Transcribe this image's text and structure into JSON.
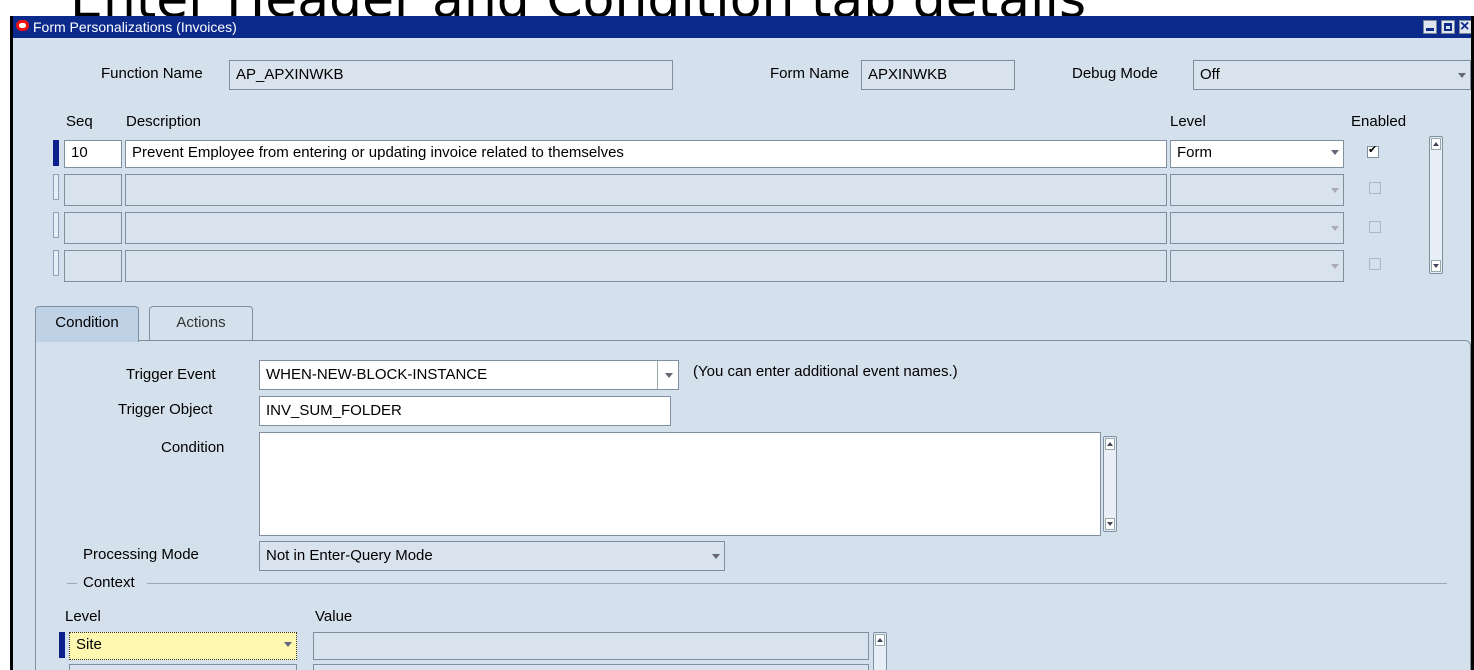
{
  "slide": {
    "heading": "Enter Header and Condition tab details"
  },
  "window": {
    "title": "Form Personalizations (Invoices)"
  },
  "header": {
    "function_name_label": "Function Name",
    "function_name_value": "AP_APXINWKB",
    "form_name_label": "Form Name",
    "form_name_value": "APXINWKB",
    "debug_mode_label": "Debug Mode",
    "debug_mode_value": "Off"
  },
  "grid": {
    "columns": {
      "seq": "Seq",
      "description": "Description",
      "level": "Level",
      "enabled": "Enabled"
    },
    "rows": [
      {
        "seq": "10",
        "description": "Prevent Employee from entering or updating invoice related to themselves",
        "level": "Form",
        "enabled": true
      },
      {
        "seq": "",
        "description": "",
        "level": "",
        "enabled": false
      },
      {
        "seq": "",
        "description": "",
        "level": "",
        "enabled": false
      },
      {
        "seq": "",
        "description": "",
        "level": "",
        "enabled": false
      }
    ]
  },
  "tabs": {
    "condition": "Condition",
    "actions": "Actions"
  },
  "condition": {
    "trigger_event_label": "Trigger Event",
    "trigger_event_value": "WHEN-NEW-BLOCK-INSTANCE",
    "trigger_event_hint": "(You can enter additional event names.)",
    "trigger_object_label": "Trigger Object",
    "trigger_object_value": "INV_SUM_FOLDER",
    "condition_label": "Condition",
    "condition_value": "",
    "processing_mode_label": "Processing Mode",
    "processing_mode_value": "Not in Enter-Query Mode",
    "context_label": "Context",
    "context_level_header": "Level",
    "context_value_header": "Value",
    "context_rows": [
      {
        "level": "Site",
        "value": ""
      }
    ]
  },
  "colors": {
    "titlebar": "#0c2a8c",
    "window_bg": "#d4e0ec",
    "selected_field": "#fff8b0"
  }
}
